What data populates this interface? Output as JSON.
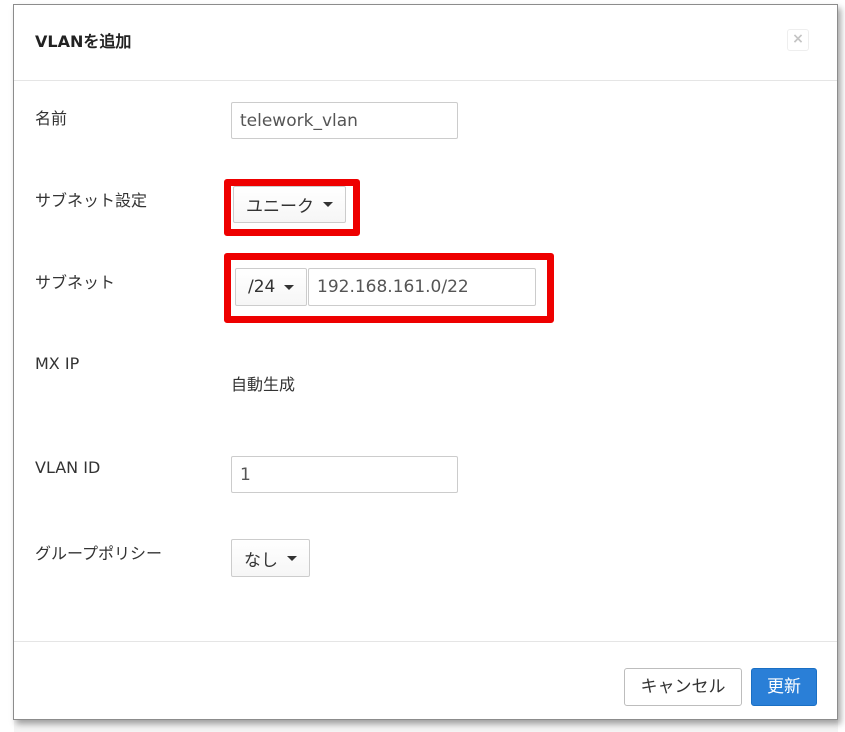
{
  "dialog": {
    "title": "VLANを追加",
    "close_label": "×"
  },
  "form": {
    "name_label": "名前",
    "name_value": "telework_vlan",
    "subnet_setting_label": "サブネット設定",
    "subnet_setting_value": "ユニーク",
    "subnet_label": "サブネット",
    "subnet_prefix_value": "/24",
    "subnet_value": "192.168.161.0/22",
    "mx_ip_label": "MX IP",
    "mx_ip_value": "自動生成",
    "vlan_id_label": "VLAN ID",
    "vlan_id_value": "1",
    "group_policy_label": "グループポリシー",
    "group_policy_value": "なし"
  },
  "footer": {
    "cancel_label": "キャンセル",
    "update_label": "更新"
  },
  "colors": {
    "highlight": "#ee0000",
    "primary": "#2a7fd7"
  }
}
